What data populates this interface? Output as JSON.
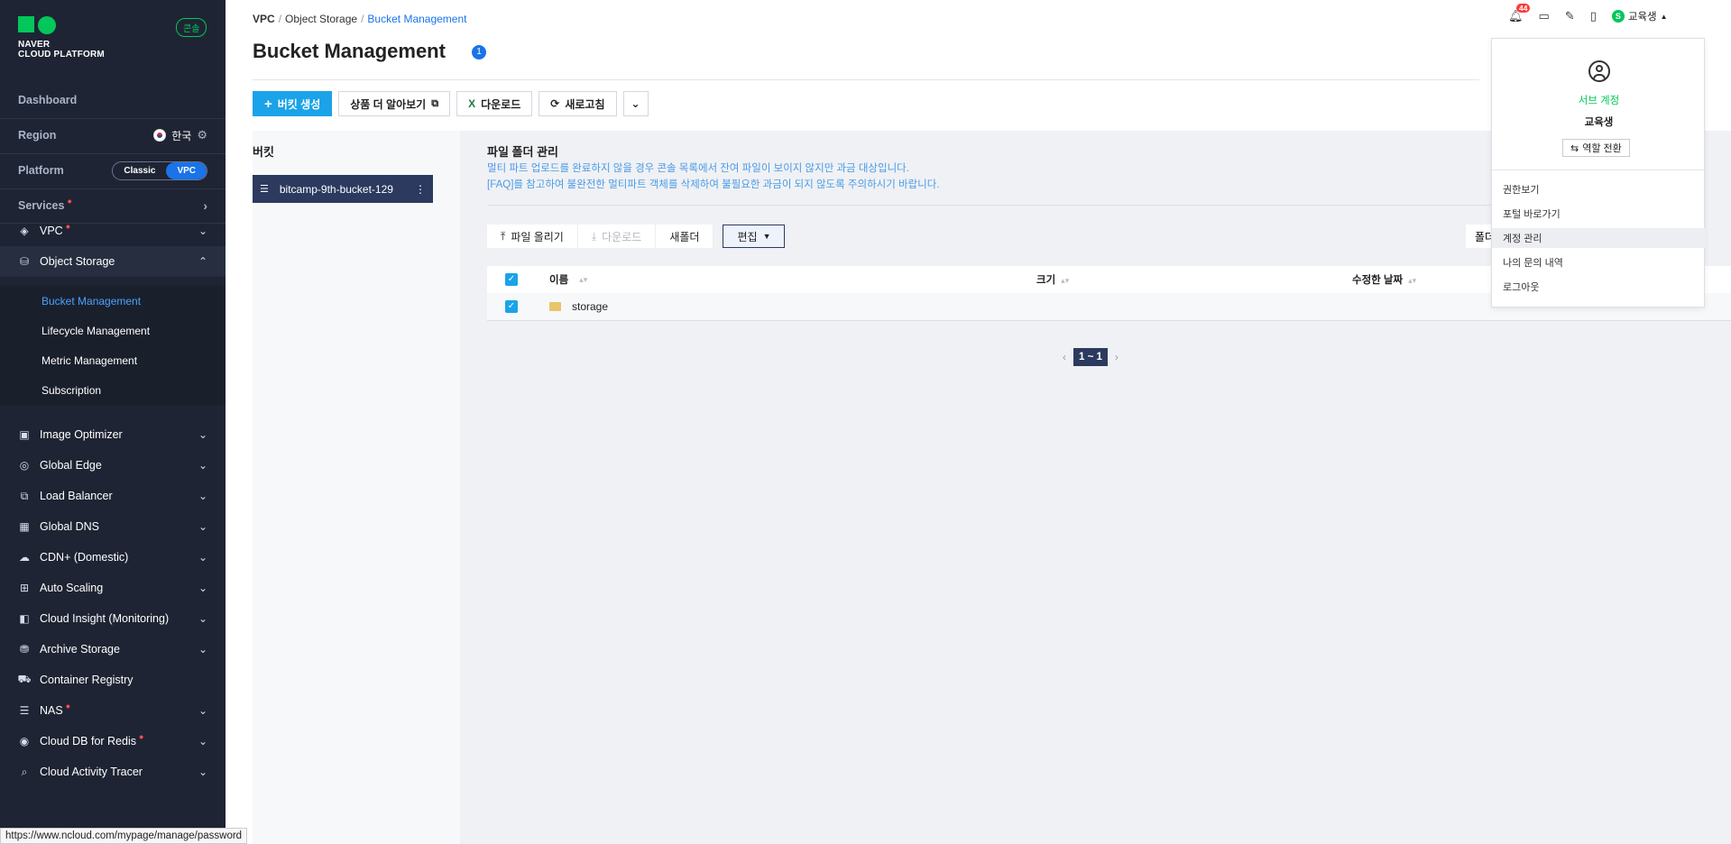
{
  "sidebar": {
    "logo_line1": "NAVER",
    "logo_line2": "CLOUD PLATFORM",
    "console_badge": "콘솔",
    "dashboard": "Dashboard",
    "region_label": "Region",
    "region_value": "한국",
    "platform_label": "Platform",
    "platform_classic": "Classic",
    "platform_vpc": "VPC",
    "services_label": "Services",
    "menu": [
      {
        "label": "VPC",
        "icon": "vpc-icon",
        "dot": true
      },
      {
        "label": "Object Storage",
        "icon": "object-storage-icon",
        "expanded": true
      },
      {
        "label": "Image Optimizer",
        "icon": "image-optimizer-icon"
      },
      {
        "label": "Global Edge",
        "icon": "global-edge-icon"
      },
      {
        "label": "Load Balancer",
        "icon": "load-balancer-icon"
      },
      {
        "label": "Global DNS",
        "icon": "global-dns-icon"
      },
      {
        "label": "CDN+ (Domestic)",
        "icon": "cdn-icon"
      },
      {
        "label": "Auto Scaling",
        "icon": "auto-scaling-icon"
      },
      {
        "label": "Cloud Insight (Monitoring)",
        "icon": "cloud-insight-icon"
      },
      {
        "label": "Archive Storage",
        "icon": "archive-storage-icon"
      },
      {
        "label": "Container Registry",
        "icon": "container-registry-icon"
      },
      {
        "label": "NAS",
        "icon": "nas-icon",
        "dot": true
      },
      {
        "label": "Cloud DB for Redis",
        "icon": "redis-icon",
        "dot": true
      },
      {
        "label": "Cloud Activity Tracer",
        "icon": "activity-tracer-icon"
      }
    ],
    "submenu": [
      "Bucket Management",
      "Lifecycle Management",
      "Metric Management",
      "Subscription"
    ],
    "status_url": "https://www.ncloud.com/mypage/manage/password"
  },
  "header": {
    "breadcrumb": [
      "VPC",
      "Object Storage",
      "Bucket Management"
    ],
    "title": "Bucket Management",
    "title_badge": "1",
    "notification_count": "44",
    "user_name": "교육생"
  },
  "toolbar": {
    "create": "버킷 생성",
    "learn_more": "상품 더 알아보기",
    "download": "다운로드",
    "refresh": "새로고침"
  },
  "buckets": {
    "heading": "버킷",
    "items": [
      "bitcamp-9th-bucket-129"
    ]
  },
  "files": {
    "heading": "파일 폴더 관리",
    "notice1": "멀티 파트 업로드를 완료하지 않을 경우 콘솔 목록에서 잔여 파일이 보이지 않지만 과금 대상입니다.",
    "notice2": "[FAQ]를 참고하여 불완전한 멀티파트 객체를 삭제하여 불필요한 과금이 되지 않도록 주의하시기 바랍니다.",
    "upload": "파일 올리기",
    "download": "다운로드",
    "new_folder": "새폴더",
    "edit": "편집",
    "folder_right": "폴더",
    "columns": [
      "이름",
      "크기",
      "수정한 날짜"
    ],
    "rows": [
      {
        "name": "storage"
      }
    ],
    "page": "1 ~ 1"
  },
  "dropdown": {
    "account_type": "서브 계정",
    "name": "교육생",
    "switch_role": "역할 전환",
    "items": [
      "권한보기",
      "포털 바로가기",
      "계정 관리",
      "나의 문의 내역",
      "로그아웃"
    ]
  },
  "colors": {
    "brand": "#03c75a",
    "primary": "#1aa3e8",
    "sidebar_bg": "#1e2433",
    "active_bucket": "#2b3a5e"
  }
}
